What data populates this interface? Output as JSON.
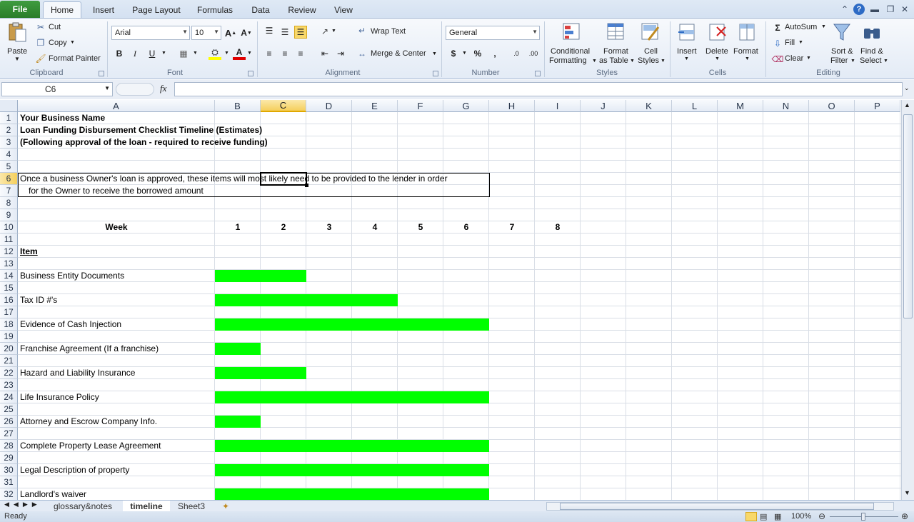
{
  "ribbon_tabs": {
    "file": "File",
    "tabs": [
      "Home",
      "Insert",
      "Page Layout",
      "Formulas",
      "Data",
      "Review",
      "View"
    ],
    "active": "Home"
  },
  "clipboard": {
    "paste": "Paste",
    "cut": "Cut",
    "copy": "Copy",
    "format_painter": "Format Painter",
    "label": "Clipboard"
  },
  "font": {
    "name": "Arial",
    "size": "10",
    "label": "Font"
  },
  "alignment": {
    "wrap_text": "Wrap Text",
    "merge_center": "Merge & Center",
    "label": "Alignment"
  },
  "number": {
    "format": "General",
    "label": "Number"
  },
  "styles": {
    "conditional_formatting_1": "Conditional",
    "conditional_formatting_2": "Formatting",
    "format_table_1": "Format",
    "format_table_2": "as Table",
    "cell_styles_1": "Cell",
    "cell_styles_2": "Styles",
    "label": "Styles"
  },
  "cells": {
    "insert": "Insert",
    "delete": "Delete",
    "format": "Format",
    "label": "Cells"
  },
  "editing": {
    "autosum": "AutoSum",
    "fill": "Fill",
    "clear": "Clear",
    "sort_1": "Sort &",
    "sort_2": "Filter",
    "find_1": "Find &",
    "find_2": "Select",
    "label": "Editing"
  },
  "formula_bar": {
    "name_box": "C6",
    "fx": "fx",
    "formula": ""
  },
  "columns": [
    "A",
    "B",
    "C",
    "D",
    "E",
    "F",
    "G",
    "H",
    "I",
    "J",
    "K",
    "L",
    "M",
    "N",
    "O",
    "P"
  ],
  "selected_column": "C",
  "selected_row": 6,
  "rows": [
    1,
    2,
    3,
    4,
    5,
    6,
    7,
    8,
    9,
    10,
    11,
    12,
    13,
    14,
    15,
    16,
    17,
    18,
    19,
    20,
    21,
    22,
    23,
    24,
    25,
    26,
    27,
    28,
    29,
    30,
    31,
    32
  ],
  "sheet": {
    "title1": "Your Business Name",
    "title2": "Loan Funding Disbursement Checklist Timeline (Estimates)",
    "title3": "(Following approval of the loan - required to receive funding)",
    "note_line1": "Once a business Owner's loan is approved, these items will most likely need to be provided to the lender in order",
    "note_line2": "for the Owner to receive the borrowed amount",
    "week_label": "Week",
    "weeks": [
      "1",
      "2",
      "3",
      "4",
      "5",
      "6",
      "7",
      "8"
    ],
    "item_label": "Item",
    "items": [
      {
        "name": "Business Entity Documents",
        "weeks": 2
      },
      {
        "name": "Tax ID #'s",
        "weeks": 4
      },
      {
        "name": "Evidence of Cash Injection",
        "weeks": 6
      },
      {
        "name": "Franchise Agreement (If a franchise)",
        "weeks": 1
      },
      {
        "name": "Hazard and Liability Insurance",
        "weeks": 2
      },
      {
        "name": "Life Insurance Policy",
        "weeks": 6
      },
      {
        "name": "Attorney and Escrow Company Info.",
        "weeks": 1
      },
      {
        "name": "Complete Property Lease Agreement",
        "weeks": 6
      },
      {
        "name": "Legal Description of property",
        "weeks": 6
      },
      {
        "name": "Landlord's waiver",
        "weeks": 6
      }
    ]
  },
  "sheet_tabs": [
    "glossary&notes",
    "timeline",
    "Sheet3"
  ],
  "active_sheet": "timeline",
  "status": {
    "ready": "Ready",
    "zoom": "100%"
  },
  "colors": {
    "bar": "#00ff00",
    "file_tab": "#2a7d2a"
  }
}
